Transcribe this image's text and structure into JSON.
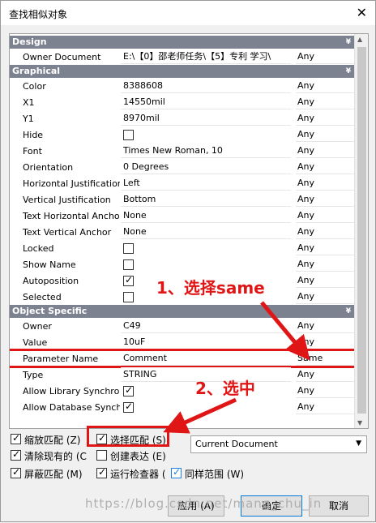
{
  "window": {
    "title": "查找相似对象",
    "close_glyph": "✕"
  },
  "sections": {
    "design": {
      "title": "Design",
      "chevron": "¥"
    },
    "graphical": {
      "title": "Graphical",
      "chevron": "¥"
    },
    "object_specific": {
      "title": "Object Specific",
      "chevron": "¥"
    }
  },
  "rows": {
    "owner_document": {
      "label": "Owner Document",
      "value": "E:\\【0】邵老师任务\\【5】专利 学习\\",
      "match": "Any"
    },
    "color": {
      "label": "Color",
      "value": "8388608",
      "match": "Any"
    },
    "x1": {
      "label": "X1",
      "value": "14550mil",
      "match": "Any"
    },
    "y1": {
      "label": "Y1",
      "value": "8970mil",
      "match": "Any"
    },
    "hide": {
      "label": "Hide",
      "checked": false,
      "match": "Any"
    },
    "font": {
      "label": "Font",
      "value": "Times New Roman, 10",
      "match": "Any"
    },
    "orientation": {
      "label": "Orientation",
      "value": "0 Degrees",
      "match": "Any"
    },
    "horizontal_justification": {
      "label": "Horizontal Justification",
      "value": "Left",
      "match": "Any"
    },
    "vertical_justification": {
      "label": "Vertical Justification",
      "value": "Bottom",
      "match": "Any"
    },
    "text_horizontal_anchor": {
      "label": "Text Horizontal Anchor",
      "value": "None",
      "match": "Any"
    },
    "text_vertical_anchor": {
      "label": "Text Vertical Anchor",
      "value": "None",
      "match": "Any"
    },
    "locked": {
      "label": "Locked",
      "checked": false,
      "match": "Any"
    },
    "show_name": {
      "label": "Show Name",
      "checked": false,
      "match": "Any"
    },
    "autoposition": {
      "label": "Autoposition",
      "checked": true,
      "match": "Any"
    },
    "selected": {
      "label": "Selected",
      "checked": false,
      "match": "Any"
    },
    "owner": {
      "label": "Owner",
      "value": "C49",
      "match": "Any"
    },
    "value": {
      "label": "Value",
      "value": "10uF",
      "match": "Any"
    },
    "parameter_name": {
      "label": "Parameter Name",
      "value": "Comment",
      "match": "Same"
    },
    "type": {
      "label": "Type",
      "value": "STRING",
      "match": "Any"
    },
    "allow_library_synchronization": {
      "label": "Allow Library Synchron",
      "checked": true,
      "match": "Any"
    },
    "allow_database_synchronization": {
      "label": "Allow Database Synchr",
      "checked": true,
      "match": "Any"
    }
  },
  "options": {
    "zoom_matching": {
      "label": "缩放匹配 (Z)",
      "checked": true
    },
    "select_matching": {
      "label": "选择匹配 (S)",
      "checked": true
    },
    "clear_existing": {
      "label": "清除现有的 (C",
      "checked": true
    },
    "create_expression": {
      "label": "创建表达 (E)",
      "checked": false
    },
    "mask_matching": {
      "label": "屏蔽匹配 (M)",
      "checked": true
    },
    "run_inspector": {
      "label": "运行检查器 (",
      "checked": true
    },
    "same_scope": {
      "label": "同样范围 (W)",
      "checked": true
    }
  },
  "scope_select": {
    "value": "Current Document"
  },
  "buttons": {
    "apply": "应用 (A)",
    "ok": "确定",
    "cancel": "取消"
  },
  "watermark": "https://blog.csdn.net/mang_chu_in",
  "annotations": {
    "step1": "1、选择same",
    "step2": "2、选中"
  },
  "colors": {
    "section_header": "#7d8290",
    "annotation_red": "#e01515",
    "focus_blue": "#0078d7"
  }
}
